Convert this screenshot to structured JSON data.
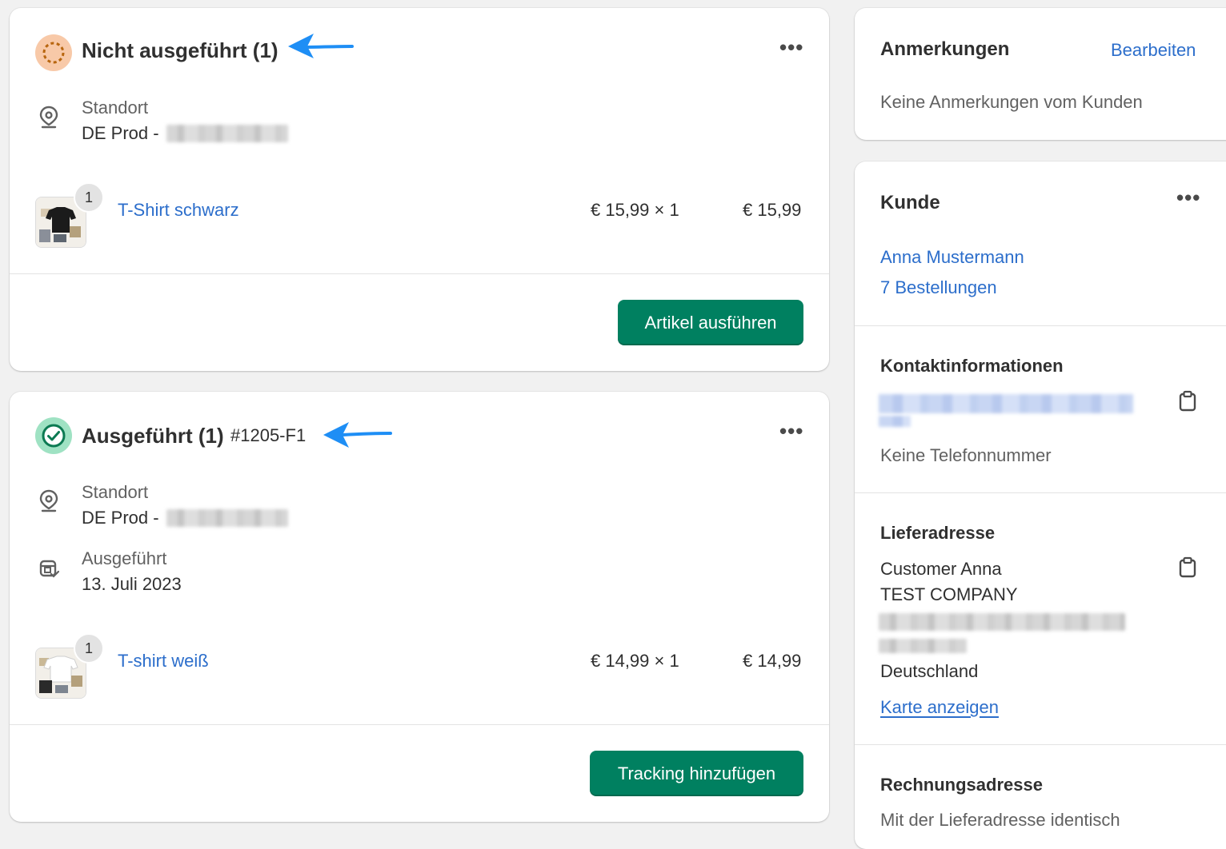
{
  "unfulfilled": {
    "title": "Nicht ausgeführt (1)",
    "more_label": "•••",
    "location_label": "Standort",
    "location_value": "DE Prod -",
    "item": {
      "badge": "1",
      "name": "T-Shirt schwarz",
      "unit_price_qty": "€ 15,99 × 1",
      "total": "€ 15,99"
    },
    "action_label": "Artikel ausführen"
  },
  "fulfilled": {
    "title": "Ausgeführt (1)",
    "order_id": "#1205-F1",
    "more_label": "•••",
    "location_label": "Standort",
    "location_value": "DE Prod -",
    "fulfilled_label": "Ausgeführt",
    "fulfilled_date": "13. Juli 2023",
    "item": {
      "badge": "1",
      "name": "T-shirt weiß",
      "unit_price_qty": "€ 14,99 × 1",
      "total": "€ 14,99"
    },
    "action_label": "Tracking hinzufügen"
  },
  "notes": {
    "title": "Anmerkungen",
    "edit_label": "Bearbeiten",
    "empty_text": "Keine Anmerkungen vom Kunden"
  },
  "customer": {
    "title": "Kunde",
    "more_label": "•••",
    "name": "Anna Mustermann",
    "orders": "7 Bestellungen",
    "contact_title": "Kontaktinformationen",
    "no_phone": "Keine Telefonnummer",
    "shipping_title": "Lieferadresse",
    "shipping_lines": [
      "Customer Anna",
      "TEST COMPANY"
    ],
    "shipping_country": "Deutschland",
    "map_link": "Karte anzeigen",
    "billing_title": "Rechnungsadresse",
    "billing_text": "Mit der Lieferadresse identisch"
  },
  "colors": {
    "primary_button": "#008060",
    "link": "#2c6ecb",
    "annotation_arrow": "#1e8ef5",
    "unfulfilled_icon": "#f5c9a8",
    "fulfilled_icon": "#9fe2c3"
  }
}
